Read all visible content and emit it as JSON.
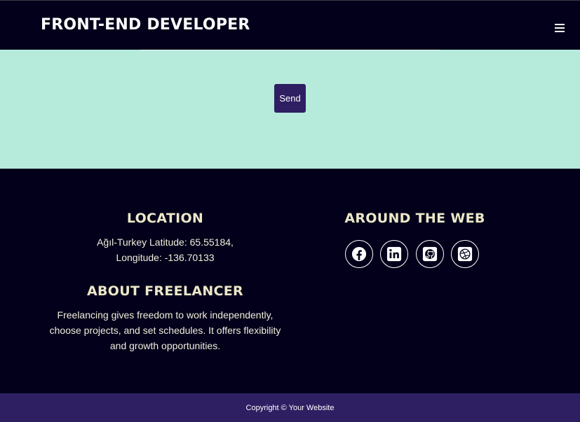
{
  "navbar": {
    "brand": "FRONT-END DEVELOPER",
    "menu_icon": "hamburger-menu-icon"
  },
  "contact": {
    "send_label": "Send"
  },
  "footer": {
    "location": {
      "title": "LOCATION",
      "line1": "Ağıl-Turkey Latitude: 65.55184,",
      "line2": "Longitude: -136.70133"
    },
    "about": {
      "title": "ABOUT FREELANCER",
      "line1": "Freelancing gives freedom to work independently,",
      "line2": "choose projects, and set schedules. It offers flexibility",
      "line3": "and growth opportunities."
    },
    "web": {
      "title": "AROUND THE WEB",
      "icons": [
        "facebook-icon",
        "linkedin-icon",
        "github-icon",
        "dribbble-icon"
      ]
    }
  },
  "copyright": {
    "text": "Copyright © Your Website"
  },
  "colors": {
    "navbar_bg": "#02001a",
    "contact_bg": "#b6eadb",
    "accent": "#2e1f63",
    "heading_text": "#ece7c8"
  }
}
